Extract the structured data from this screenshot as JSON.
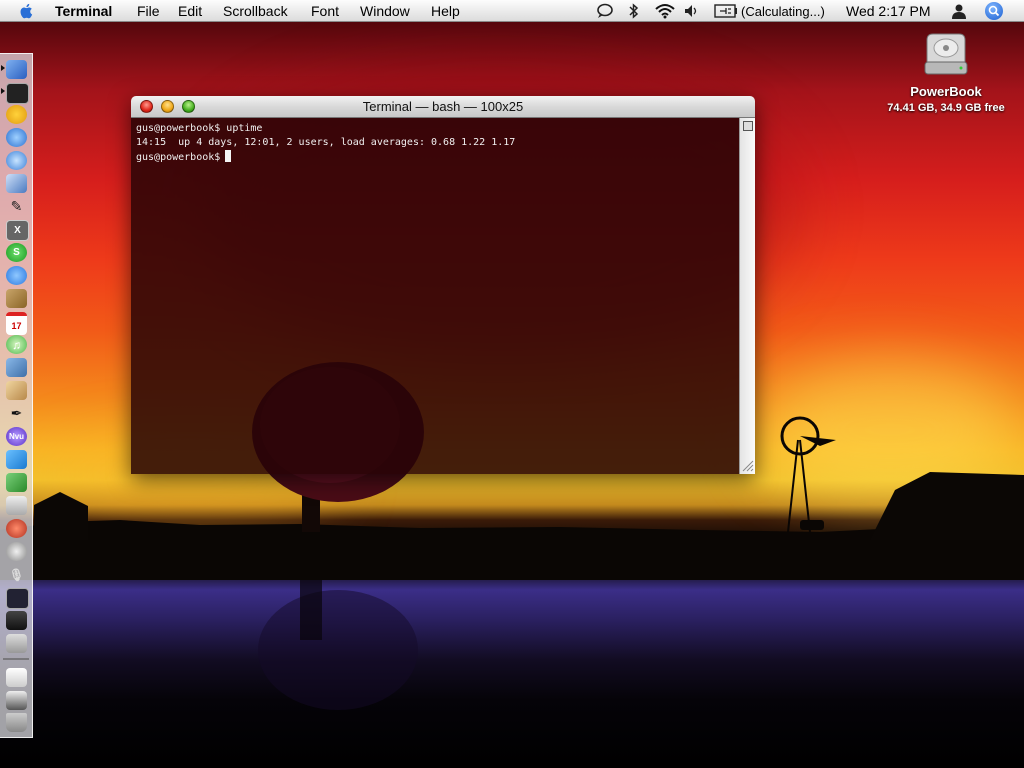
{
  "menubar": {
    "app_name": "Terminal",
    "menus": [
      "File",
      "Edit",
      "Scrollback",
      "Font",
      "Window",
      "Help"
    ],
    "battery_status": "(Calculating...)",
    "clock": "Wed 2:17 PM"
  },
  "window": {
    "title": "Terminal — bash — 100x25",
    "lines": [
      "gus@powerbook$ uptime",
      "14:15  up 4 days, 12:01, 2 users, load averages: 0.68 1.22 1.17"
    ],
    "prompt": "gus@powerbook$"
  },
  "desktop": {
    "drive_name": "PowerBook",
    "drive_info": "74.41 GB, 34.9 GB free"
  },
  "dock": {
    "icons": [
      "finder-icon",
      "terminal-icon",
      "adium-icon",
      "network-icon",
      "safari-icon",
      "preview-icon",
      "script-editor-icon",
      "x11-icon",
      "skype-icon",
      "ichat-icon",
      "address-book-icon",
      "ical-icon",
      "itunes-icon",
      "iphoto-icon",
      "gimp-icon",
      "textmate-icon",
      "nvu-icon",
      "dreamweaver-icon",
      "money-icon",
      "calculator-icon",
      "audio-icon",
      "disk-utility-icon",
      "microphone-icon",
      "activity-monitor-icon",
      "spreadsheet-icon",
      "system-preferences-icon",
      "document-icon",
      "printer-icon",
      "trash-icon"
    ]
  }
}
